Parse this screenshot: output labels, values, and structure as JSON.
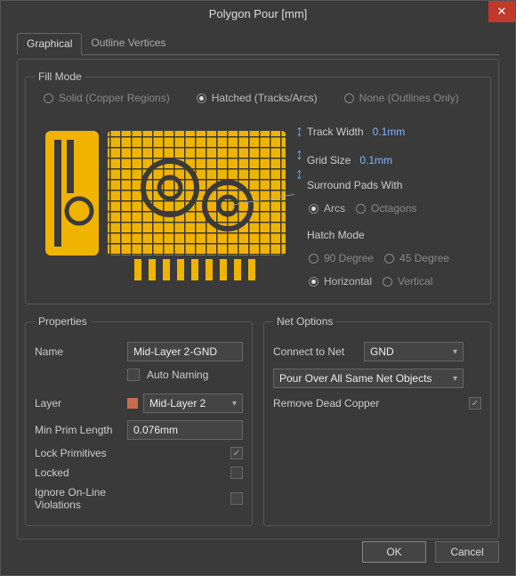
{
  "title": "Polygon Pour [mm]",
  "tabs": {
    "graphical": "Graphical",
    "outline": "Outline Vertices"
  },
  "fill_mode": {
    "legend": "Fill Mode",
    "solid": "Solid (Copper Regions)",
    "hatched": "Hatched (Tracks/Arcs)",
    "none": "None (Outlines Only)"
  },
  "params": {
    "track_width_label": "Track Width",
    "track_width_value": "0.1mm",
    "grid_size_label": "Grid Size",
    "grid_size_value": "0.1mm",
    "surround_label": "Surround Pads With",
    "arcs": "Arcs",
    "octagons": "Octagons",
    "hatch_mode_label": "Hatch Mode",
    "deg90": "90 Degree",
    "deg45": "45 Degree",
    "horizontal": "Horizontal",
    "vertical": "Vertical"
  },
  "properties": {
    "legend": "Properties",
    "name_label": "Name",
    "name_value": "Mid-Layer 2-GND",
    "auto_naming": "Auto Naming",
    "layer_label": "Layer",
    "layer_value": "Mid-Layer 2",
    "min_prim_label": "Min Prim Length",
    "min_prim_value": "0.076mm",
    "lock_prims": "Lock Primitives",
    "locked": "Locked",
    "ignore_viol": "Ignore On-Line Violations"
  },
  "net": {
    "legend": "Net Options",
    "connect_label": "Connect to Net",
    "connect_value": "GND",
    "pour_value": "Pour Over All Same Net Objects",
    "remove_dead": "Remove Dead Copper"
  },
  "buttons": {
    "ok": "OK",
    "cancel": "Cancel"
  }
}
